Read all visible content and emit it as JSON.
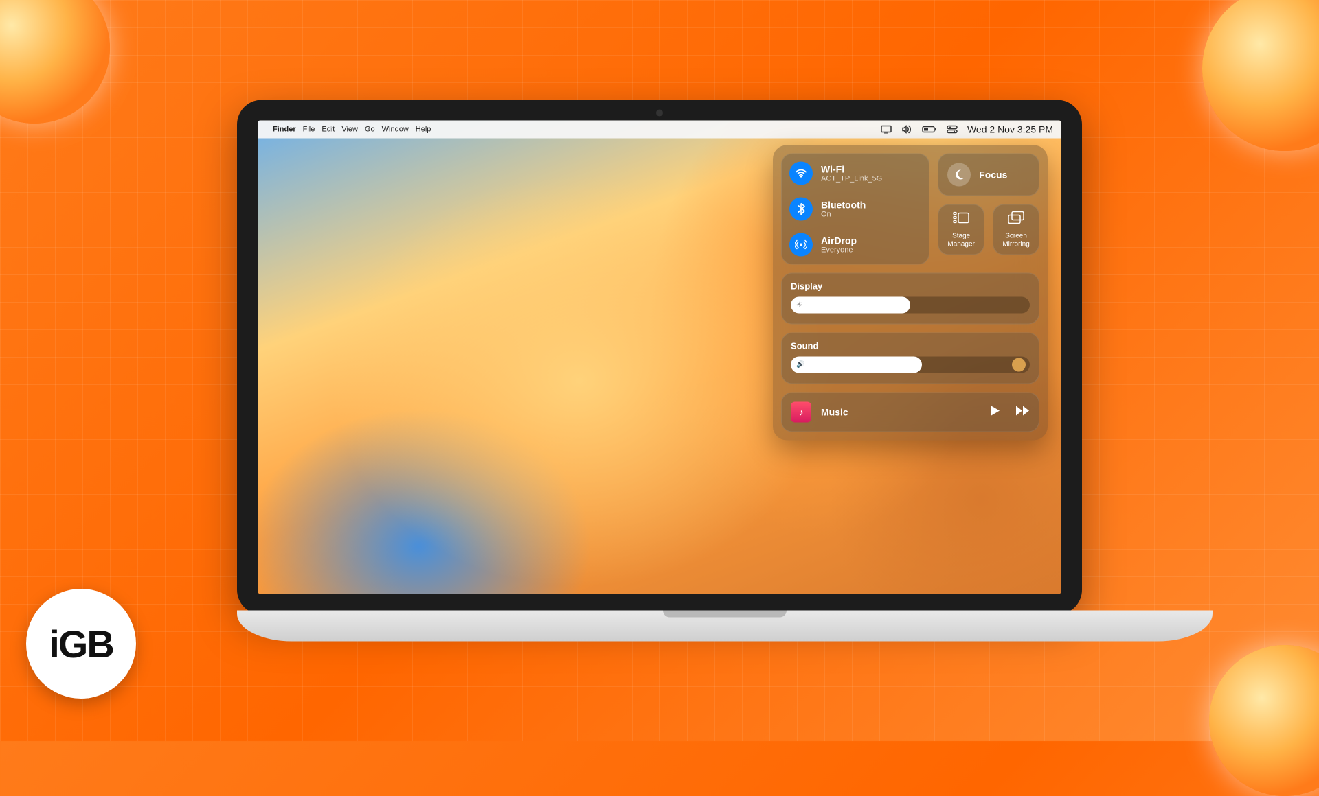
{
  "badge": "iGB",
  "menubar": {
    "app": "Finder",
    "items": [
      "File",
      "Edit",
      "View",
      "Go",
      "Window",
      "Help"
    ],
    "datetime": "Wed 2 Nov  3:25 PM"
  },
  "cc": {
    "wifi": {
      "title": "Wi-Fi",
      "sub": "ACT_TP_Link_5G"
    },
    "bluetooth": {
      "title": "Bluetooth",
      "sub": "On"
    },
    "airdrop": {
      "title": "AirDrop",
      "sub": "Everyone"
    },
    "focus": {
      "title": "Focus"
    },
    "stage": {
      "label": "Stage Manager"
    },
    "mirror": {
      "label": "Screen Mirroring"
    },
    "display": {
      "label": "Display",
      "value": 50
    },
    "sound": {
      "label": "Sound",
      "value": 55
    },
    "media": {
      "title": "Music"
    }
  }
}
